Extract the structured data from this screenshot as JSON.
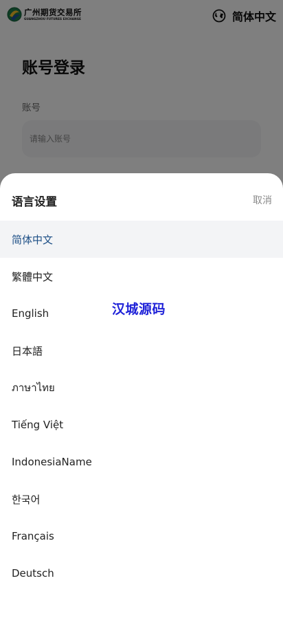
{
  "header": {
    "logo": {
      "name_cn": "广州期货交易所",
      "name_en": "GUANGZHOU FUTURES EXCHANGE"
    },
    "current_language": "简体中文",
    "globe_icon": "globe-icon"
  },
  "login": {
    "title": "账号登录",
    "account_label": "账号",
    "account_value": "",
    "account_placeholder": "请输入账号"
  },
  "language_sheet": {
    "title": "语言设置",
    "cancel_label": "取消",
    "selected_color": "#1d4f86",
    "options": [
      {
        "label": "简体中文",
        "selected": true
      },
      {
        "label": "繁體中文",
        "selected": false
      },
      {
        "label": "English",
        "selected": false
      },
      {
        "label": "日本語",
        "selected": false
      },
      {
        "label": "ภาษาไทย",
        "selected": false
      },
      {
        "label": "Tiếng Việt",
        "selected": false
      },
      {
        "label": "IndonesiaName",
        "selected": false
      },
      {
        "label": "한국어",
        "selected": false
      },
      {
        "label": "Français",
        "selected": false
      },
      {
        "label": "Deutsch",
        "selected": false
      }
    ]
  },
  "watermark": "汉城源码",
  "colors": {
    "overlay": "rgba(0,0,0,0.5)",
    "selected_row_bg": "#f3f4f6",
    "input_bg": "#f4f5f7",
    "watermark": "#1f22d8"
  }
}
